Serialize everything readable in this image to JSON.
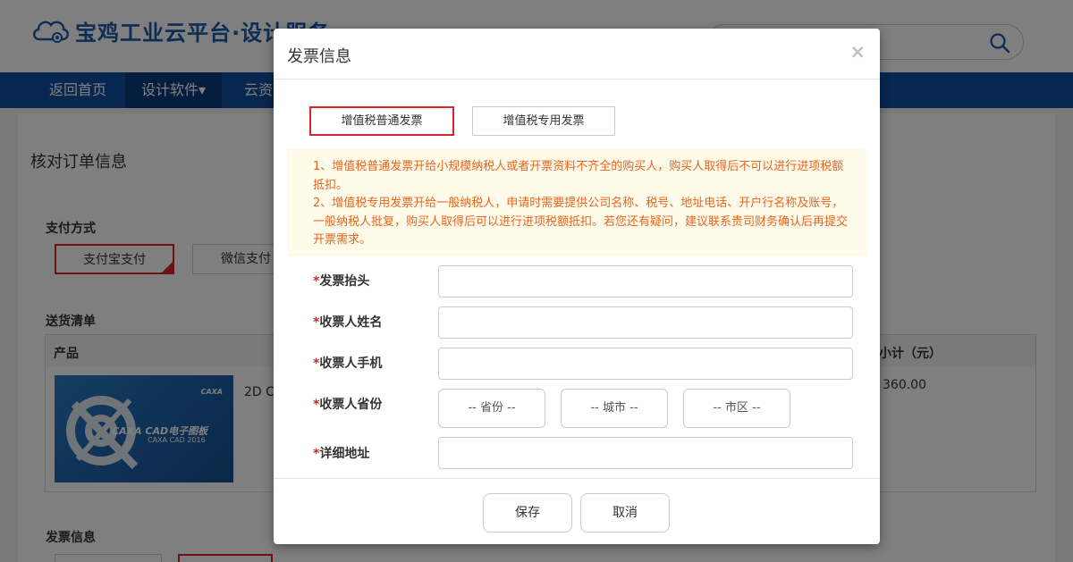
{
  "header": {
    "logo_text": "宝鸡工业云平台·设计服务"
  },
  "nav": {
    "items": [
      {
        "label": "返回首页"
      },
      {
        "label": "设计软件▾"
      },
      {
        "label": "云资"
      }
    ]
  },
  "page": {
    "title": "核对订单信息",
    "payment_label": "支付方式",
    "payment_options": [
      "支付宝支付",
      "微信支付"
    ],
    "delivery_label": "送货清单",
    "table_headers": {
      "product": "产品",
      "subtotal": "小计（元）"
    },
    "product": {
      "name": "2D C",
      "price": "360.00",
      "image_brand": "CAXA",
      "image_title": "CAXA CAD电子图板",
      "image_sub": "CAXA CAD 2016"
    },
    "invoice_label": "发票信息"
  },
  "modal": {
    "title": "发票信息",
    "close": "×",
    "invoice_types": [
      "增值税普通发票",
      "增值税专用发票"
    ],
    "notice_lines": [
      "1、增值税普通发票开给小规模纳税人或者开票资料不齐全的购买人，购买人取得后不可以进行进项税额抵扣。",
      "2、增值税专用发票开给一般纳税人，申请时需要提供公司名称、税号、地址电话、开户行名称及账号，一般纳税人批复，购买人取得后可以进行进项税额抵扣。若您还有疑问，建议联系贵司财务确认后再提交开票需求。"
    ],
    "fields": {
      "required_mark": "*",
      "title_label": "发票抬头",
      "name_label": "收票人姓名",
      "phone_label": "收票人手机",
      "province_label": "收票人省份",
      "address_label": "详细地址"
    },
    "selects": {
      "province": "-- 省份 --",
      "city": "-- 城市 --",
      "district": "-- 市区 --"
    },
    "buttons": {
      "save": "保存",
      "cancel": "取消"
    }
  },
  "colors": {
    "brand_blue": "#0e4fa0",
    "accent_red": "#d9232d",
    "notice_orange": "#e8641d",
    "notice_bg": "#fffbea"
  }
}
